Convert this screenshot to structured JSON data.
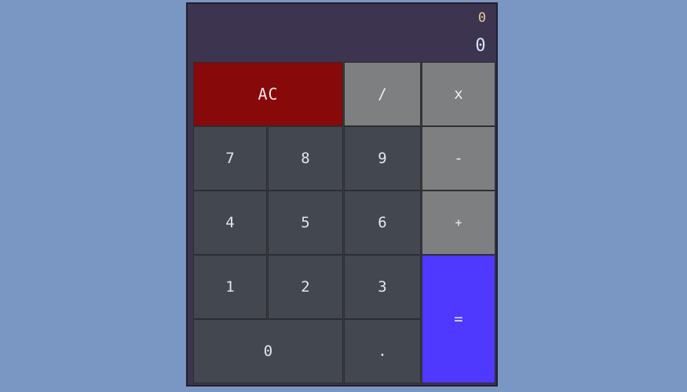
{
  "display": {
    "previous": "0",
    "current": "0"
  },
  "keys": {
    "clear": "AC",
    "divide": "/",
    "multiply": "x",
    "subtract": "-",
    "add": "+",
    "equals": "=",
    "decimal": ".",
    "d0": "0",
    "d1": "1",
    "d2": "2",
    "d3": "3",
    "d4": "4",
    "d5": "5",
    "d6": "6",
    "d7": "7",
    "d8": "8",
    "d9": "9"
  },
  "colors": {
    "page_background": "#7a96c2",
    "calculator_body": "#3d3450",
    "number_key": "#434850",
    "operator_key": "#7e7f80",
    "clear_key": "#870909",
    "equals_key": "#4f38ff",
    "display_previous": "#e8c99a",
    "display_current": "#d8e4ff"
  }
}
